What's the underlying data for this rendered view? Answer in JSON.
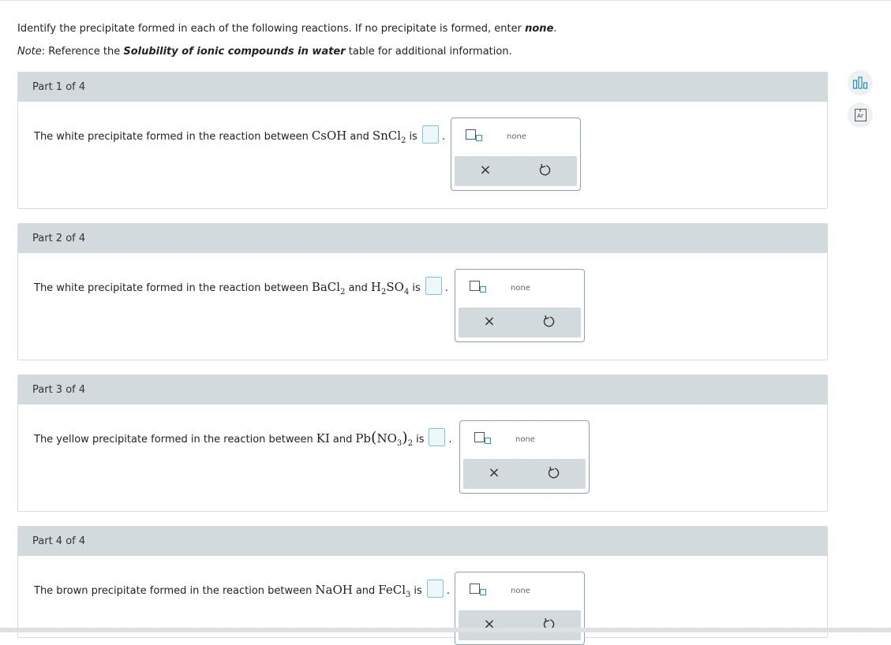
{
  "intro": {
    "line1_a": "Identify the precipitate formed in each of the following reactions. If no precipitate is formed, enter ",
    "line1_b": "none",
    "line1_c": ".",
    "note_label": "Note",
    "note_a": ": Reference the ",
    "note_b": "Solubility of ionic compounds in water",
    "note_c": " table for additional information."
  },
  "parts": [
    {
      "header": "Part 1 of 4",
      "prefix": "The white precipitate formed in the reaction between",
      "reactant1": "CsOH",
      "and": "and",
      "reactant2_base": "SnCl",
      "reactant2_sub": "2",
      "is": "is",
      "period": "."
    },
    {
      "header": "Part 2 of 4",
      "prefix": "The white precipitate formed in the reaction between",
      "reactant1_base": "BaCl",
      "reactant1_sub": "2",
      "and": "and",
      "reactant2_a": "H",
      "reactant2_sub1": "2",
      "reactant2_b": "SO",
      "reactant2_sub2": "4",
      "is": "is",
      "period": "."
    },
    {
      "header": "Part 3 of 4",
      "prefix": "The yellow precipitate formed in the reaction between",
      "reactant1": "KI",
      "and": "and",
      "reactant2_a": "Pb",
      "reactant2_open": "(",
      "reactant2_b": "NO",
      "reactant2_sub1": "3",
      "reactant2_close": ")",
      "reactant2_sub2": "2",
      "is": "is",
      "period": "."
    },
    {
      "header": "Part 4 of 4",
      "prefix": "The brown precipitate formed in the reaction between",
      "reactant1": "NaOH",
      "and": "and",
      "reactant2_base": "FeCl",
      "reactant2_sub": "3",
      "is": "is",
      "period": "."
    }
  ],
  "palette": {
    "none_label": "none",
    "clear_symbol": "×",
    "subscript_icon": "subscript-template-icon",
    "undo_icon": "undo-icon"
  },
  "sidebar": {
    "chart_icon": "bar-chart-icon",
    "periodic_icon": "periodic-table-icon",
    "periodic_top": "ii",
    "periodic_label": "Ar"
  },
  "colors": {
    "header_bg": "#d3dadd",
    "accent": "#1e9dbb",
    "input_border": "#7fc4d8"
  }
}
